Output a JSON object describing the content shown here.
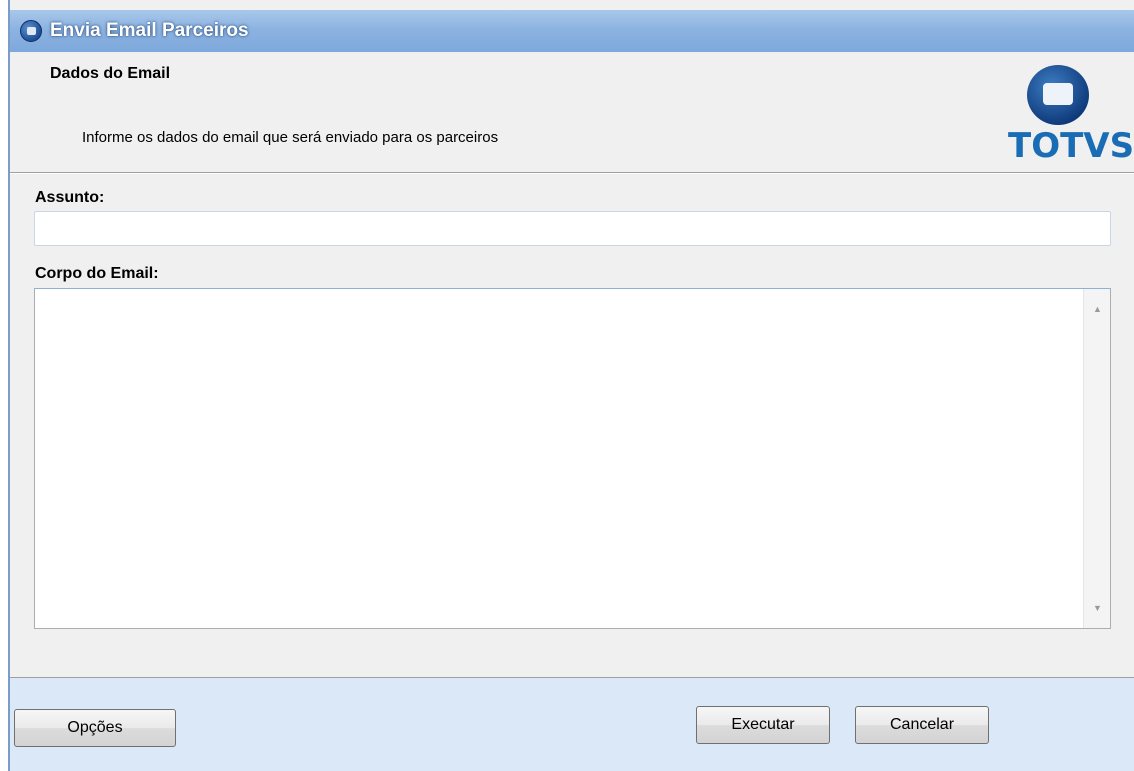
{
  "window": {
    "title": "Envia Email Parceiros"
  },
  "header": {
    "title": "Dados do Email",
    "description": "Informe os dados do email que será enviado para os parceiros",
    "logo_text": "TOTVS",
    "logo_icon": "totvs-logo-icon"
  },
  "form": {
    "subject_label": "Assunto:",
    "subject_value": "",
    "body_label": "Corpo do Email:",
    "body_value": ""
  },
  "footer": {
    "options_label": "Opções",
    "execute_label": "Executar",
    "cancel_label": "Cancelar"
  },
  "colors": {
    "titlebar": "#8cb3e1",
    "footer_bg": "#dbe8f7",
    "logo_blue": "#1a6db4"
  }
}
